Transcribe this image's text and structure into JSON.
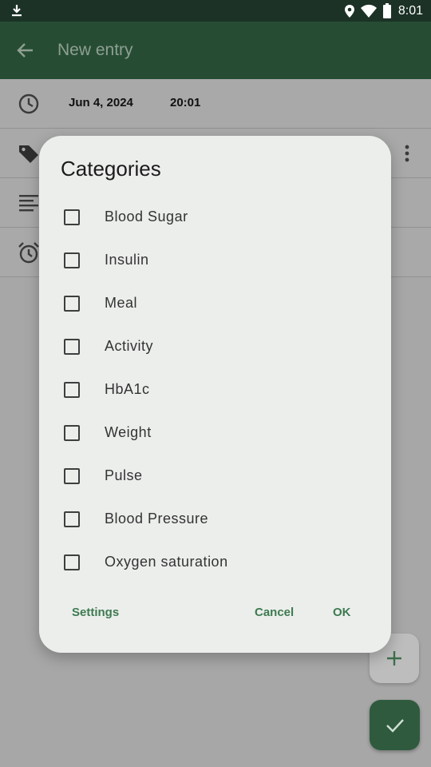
{
  "status_bar": {
    "time": "8:01"
  },
  "app_bar": {
    "title": "New entry"
  },
  "entry": {
    "date": "Jun 4, 2024",
    "time": "20:01"
  },
  "dialog": {
    "title": "Categories",
    "options": [
      {
        "label": "Blood Sugar",
        "checked": false
      },
      {
        "label": "Insulin",
        "checked": false
      },
      {
        "label": "Meal",
        "checked": false
      },
      {
        "label": "Activity",
        "checked": false
      },
      {
        "label": "HbA1c",
        "checked": false
      },
      {
        "label": "Weight",
        "checked": false
      },
      {
        "label": "Pulse",
        "checked": false
      },
      {
        "label": "Blood Pressure",
        "checked": false
      },
      {
        "label": "Oxygen saturation",
        "checked": false
      }
    ],
    "buttons": {
      "settings": "Settings",
      "cancel": "Cancel",
      "ok": "OK"
    }
  },
  "colors": {
    "primary": "#264d33",
    "accent": "#3d7a50",
    "dialog_bg": "#eceeec",
    "scrim": "#a7a7a7"
  }
}
